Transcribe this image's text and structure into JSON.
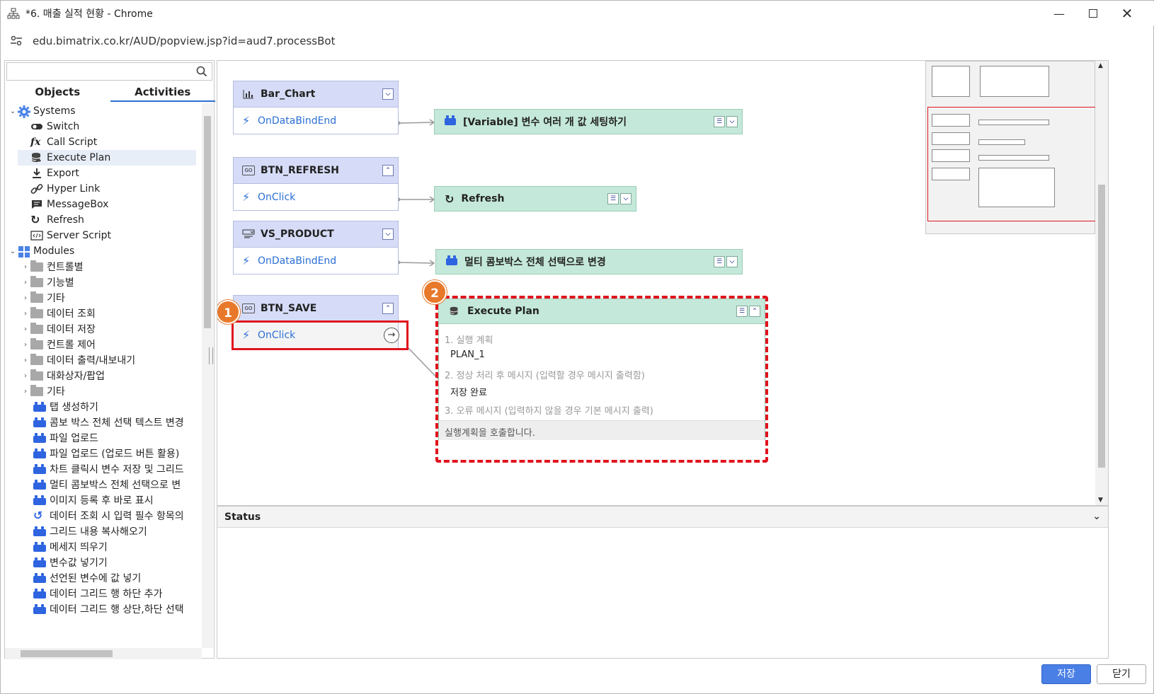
{
  "window": {
    "title": "*6. 매출 실적 현황 - Chrome",
    "url": "edu.bimatrix.co.kr/AUD/popview.jsp?id=aud7.processBot"
  },
  "left_panel": {
    "search_placeholder": "",
    "tabs": [
      "Objects",
      "Activities"
    ],
    "active_tab": "Activities",
    "systems_label": "Systems",
    "systems_items": [
      "Switch",
      "Call Script",
      "Execute Plan",
      "Export",
      "Hyper Link",
      "MessageBox",
      "Refresh",
      "Server Script"
    ],
    "modules_label": "Modules",
    "folders": [
      "컨트롤별",
      "기능별",
      "기타",
      "데이터 조회",
      "데이터 저장",
      "컨트롤 제어",
      "데이터 출력/내보내기",
      "대화상자/팝업",
      "기타"
    ],
    "modules": [
      "탭 생성하기",
      "콤보 박스 전체 선택 텍스트 변경",
      "파일 업로드",
      "파일 업로드 (업로드 버튼 활용)",
      "차트 클릭시 변수 저장 및 그리드",
      "멀티 콤보박스 전체 선택으로 변",
      "이미지 등록 후 바로 표시",
      "데이터 조회 시 입력 필수 항목의",
      "그리드 내용 복사해오기",
      "메세지 띄우기",
      "변수값 넣기기",
      "선언된 변수에 값 넣기",
      "데이터 그리드 행 하단 추가",
      "데이터 그리드 행 상단,하단 선택"
    ]
  },
  "flow": {
    "controls": [
      {
        "name": "Bar_Chart",
        "event": "OnDataBindEnd"
      },
      {
        "name": "BTN_REFRESH",
        "event": "OnClick"
      },
      {
        "name": "VS_PRODUCT",
        "event": "OnDataBindEnd"
      },
      {
        "name": "BTN_SAVE",
        "event": "OnClick"
      }
    ],
    "actions": [
      {
        "label": "[Variable] 변수 여러 개 값 세팅하기"
      },
      {
        "label": "Refresh"
      },
      {
        "label": "멀티 콤보박스 전체 선택으로 변경"
      }
    ],
    "execute_plan": {
      "title": "Execute Plan",
      "field1_label": "1. 실행 계획",
      "field1_value": "PLAN_1",
      "field2_label": "2. 정상 처리 후 메시지 (입력할 경우 메시지 출력함)",
      "field2_value": "저장 완료",
      "field3_label": "3. 오류 메시지 (입력하지 않을 경우 기본 메시지 출력)",
      "description": "실행계획을 호출합니다."
    },
    "badges": [
      "1",
      "2"
    ]
  },
  "status_panel": {
    "title": "Status"
  },
  "footer": {
    "save_label": "저장",
    "close_label": "닫기"
  },
  "colors": {
    "accent": "#2b6fd6",
    "control_node": "#d6dcf7",
    "action_node": "#c4e8d9",
    "highlight": "#e0141e",
    "badge": "#e8782a"
  }
}
